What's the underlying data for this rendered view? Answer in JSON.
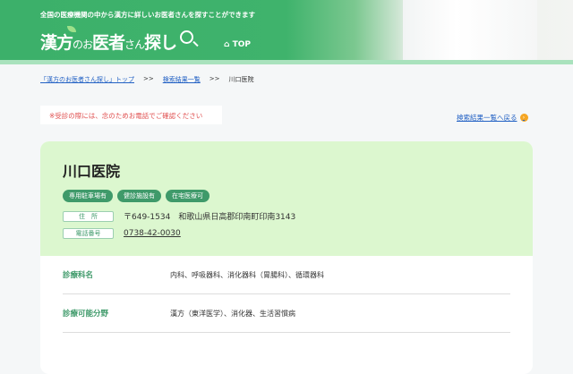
{
  "header": {
    "tagline": "全国の医療機関の中から漢方に詳しいお医者さんを探すことができます",
    "logo_main": "漢方",
    "logo_no": "のお",
    "logo_mid": "医者",
    "logo_san": "さん",
    "logo_end": "探し",
    "top_label": "TOP"
  },
  "breadcrumb": {
    "items": [
      "「漢方のお医者さん探し」トップ",
      "検索結果一覧",
      "川口医院"
    ],
    "sep": ">>"
  },
  "notice": "※受診の際には、念のためお電話でご確認ください",
  "back_link": "検索結果一覧へ戻る",
  "clinic": {
    "name": "川口医院",
    "tags": [
      "専用駐車場有",
      "健診施設有",
      "在宅医療可"
    ],
    "address_label": "住　所",
    "address": "〒649-1534　和歌山県日高郡印南町印南3143",
    "phone_label": "電話番号",
    "phone": "0738-42-0030"
  },
  "info": [
    {
      "key": "診療科名",
      "value": "内科、呼吸器科、消化器科（胃腸科）、循環器科"
    },
    {
      "key": "診療可能分野",
      "value": "漢方（東洋医学）、消化器、生活習慣病"
    }
  ],
  "colors": {
    "brand": "#3cb06a",
    "tag": "#3f9a6a",
    "notice": "#e05050",
    "link": "#2261c4"
  }
}
